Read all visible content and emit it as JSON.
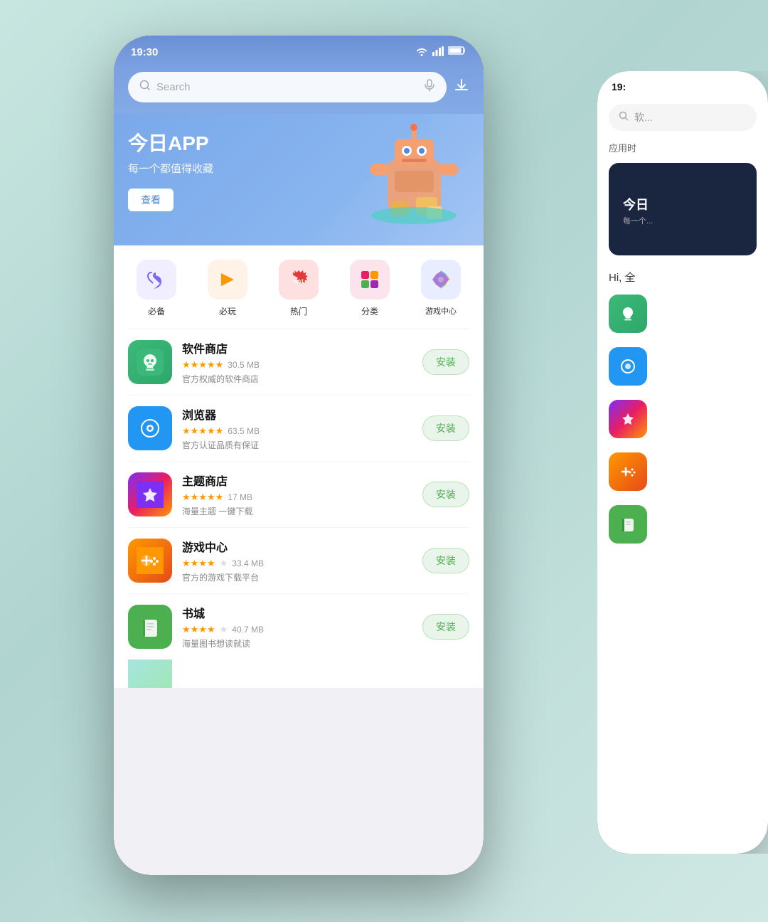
{
  "background": {
    "color": "#c0ddd8"
  },
  "phone_main": {
    "status_bar": {
      "time": "19:30",
      "wifi": "📶",
      "signal": "▪▪▪",
      "battery": "🔋"
    },
    "search": {
      "placeholder": "Search",
      "mic_icon": "mic",
      "download_icon": "download"
    },
    "banner": {
      "title": "今日APP",
      "subtitle": "每一个都值得收藏",
      "button_label": "查看"
    },
    "categories": [
      {
        "id": "essential",
        "icon": "👍",
        "label": "必备",
        "color": "#f0eeff"
      },
      {
        "id": "play",
        "icon": "🎮",
        "label": "必玩",
        "color": "#fff3e8"
      },
      {
        "id": "hot",
        "icon": "🔥",
        "label": "热门",
        "color": "#ffeeee"
      },
      {
        "id": "category",
        "icon": "⊞",
        "label": "分类",
        "color": "#fff0f8"
      },
      {
        "id": "game-center",
        "icon": "⭐",
        "label": "游戏中心",
        "color": "#f0f4ff"
      }
    ],
    "apps": [
      {
        "id": "app-store",
        "name": "软件商店",
        "stars": 5,
        "stars_display": "★★★★★",
        "size": "30.5 MB",
        "desc": "官方权威的软件商店",
        "install_label": "安装",
        "icon_color_start": "#3cb878",
        "icon_color_end": "#2da86a",
        "icon_symbol": "🏪"
      },
      {
        "id": "browser",
        "name": "浏览器",
        "stars": 5,
        "stars_display": "★★★★★",
        "size": "63.5 MB",
        "desc": "官方认证品质有保证",
        "install_label": "安装",
        "icon_color": "#2196F3",
        "icon_symbol": "🌐"
      },
      {
        "id": "theme-store",
        "name": "主题商店",
        "stars": 5,
        "stars_display": "★★★★★",
        "size": "17 MB",
        "desc": "海量主题 一键下载",
        "install_label": "安装",
        "icon_symbol": "🎨"
      },
      {
        "id": "game-center",
        "name": "游戏中心",
        "stars": 4,
        "stars_display": "★★★★☆",
        "size": "33.4 MB",
        "desc": "官方的游戏下载平台",
        "install_label": "安装",
        "icon_symbol": "🎮"
      },
      {
        "id": "book-city",
        "name": "书城",
        "stars": 4,
        "stars_display": "★★★★☆",
        "size": "40.7 MB",
        "desc": "海量图书想读就读",
        "install_label": "安装",
        "icon_symbol": "📚"
      }
    ]
  },
  "phone_second": {
    "status_bar": {
      "time": "19:"
    },
    "search": {
      "placeholder": "软..."
    },
    "section_label": "应用时",
    "banner": {
      "tag": "",
      "title": "今日",
      "subtitle": "每一个..."
    },
    "greeting": "Hi, 全",
    "apps": [
      {
        "id": "app-store-2",
        "icon": "🏪",
        "color": "#3cb878"
      },
      {
        "id": "browser-2",
        "icon": "💬",
        "color": "#2196F3"
      },
      {
        "id": "theme-2",
        "icon": "🎨",
        "color": "#9c27b0"
      },
      {
        "id": "game-2",
        "icon": "🎮",
        "color": "#ff9800"
      },
      {
        "id": "book-2",
        "icon": "📚",
        "color": "#4CAF50"
      }
    ]
  }
}
